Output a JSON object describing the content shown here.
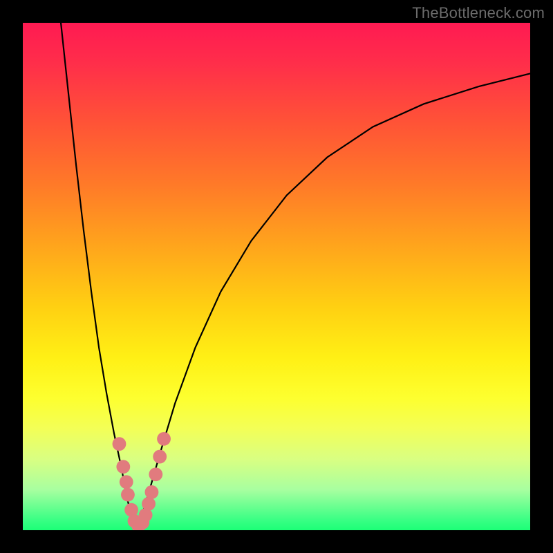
{
  "watermark": "TheBottleneck.com",
  "chart_data": {
    "type": "line",
    "title": "",
    "xlabel": "",
    "ylabel": "",
    "xlim": [
      0,
      100
    ],
    "ylim": [
      0,
      100
    ],
    "note": "Axes are unlabeled in the source image; values are normalized 0–100 by pixel position. Y increases upward.",
    "series": [
      {
        "name": "left-branch",
        "x": [
          7.5,
          9.0,
          10.5,
          12.0,
          13.5,
          15.0,
          16.5,
          18.0,
          19.5,
          20.5,
          21.5,
          22.5
        ],
        "y": [
          100,
          86,
          72,
          59,
          47,
          36,
          27,
          19,
          12,
          6.5,
          2.5,
          0.5
        ]
      },
      {
        "name": "right-branch",
        "x": [
          22.5,
          23.5,
          25.0,
          27.0,
          30.0,
          34.0,
          39.0,
          45.0,
          52.0,
          60.0,
          69.0,
          79.0,
          90.0,
          100.0
        ],
        "y": [
          0.5,
          3.0,
          8.0,
          15.0,
          25.0,
          36.0,
          47.0,
          57.0,
          66.0,
          73.5,
          79.5,
          84.0,
          87.5,
          90.0
        ]
      }
    ],
    "scatter": {
      "name": "highlight-dots",
      "color": "#e17b7e",
      "radius_pct": 1.35,
      "points": [
        {
          "x": 19.0,
          "y": 17.0
        },
        {
          "x": 19.8,
          "y": 12.5
        },
        {
          "x": 20.4,
          "y": 9.5
        },
        {
          "x": 20.7,
          "y": 7.0
        },
        {
          "x": 21.4,
          "y": 4.0
        },
        {
          "x": 22.0,
          "y": 1.8
        },
        {
          "x": 22.8,
          "y": 0.8
        },
        {
          "x": 23.6,
          "y": 1.5
        },
        {
          "x": 24.2,
          "y": 3.0
        },
        {
          "x": 24.8,
          "y": 5.2
        },
        {
          "x": 25.4,
          "y": 7.5
        },
        {
          "x": 26.2,
          "y": 11.0
        },
        {
          "x": 27.0,
          "y": 14.5
        },
        {
          "x": 27.8,
          "y": 18.0
        }
      ]
    },
    "gradient_bands_pct_from_top": [
      {
        "color": "#ff1a52",
        "at": 0
      },
      {
        "color": "#ffa51c",
        "at": 44
      },
      {
        "color": "#fff015",
        "at": 66
      },
      {
        "color": "#1cff77",
        "at": 100
      }
    ]
  }
}
